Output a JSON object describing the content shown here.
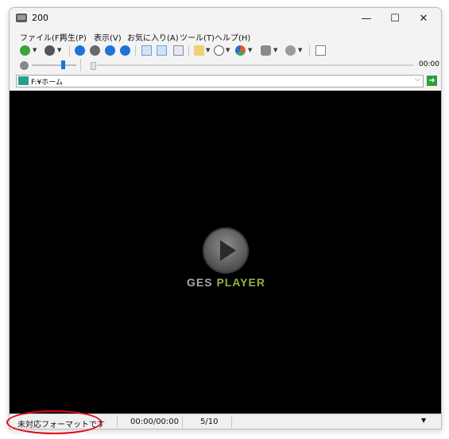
{
  "window": {
    "title": "200"
  },
  "menubar": {
    "items": [
      {
        "label": "ファイル(F)"
      },
      {
        "label": "再生(P)"
      },
      {
        "label": "表示(V)"
      },
      {
        "label": "お気に入り(A)"
      },
      {
        "label": "ツール(T)"
      },
      {
        "label": "ヘルプ(H)"
      }
    ]
  },
  "seek": {
    "time": "00:00",
    "volume_level": 0.72,
    "position": 0
  },
  "address": {
    "path": "F:¥ホーム"
  },
  "video": {
    "logo": {
      "word1": "GES",
      "word2": "PLAYER",
      "word1_color": "#a8a8a8",
      "word2_color": "#8fb33a"
    }
  },
  "statusbar": {
    "message": "未対応フォーマットです",
    "time": "00:00/00:00",
    "track": "5/10"
  },
  "colors": {
    "accent_blue": "#1e73d8",
    "green": "#3aa537",
    "annotation": "#e60012"
  }
}
